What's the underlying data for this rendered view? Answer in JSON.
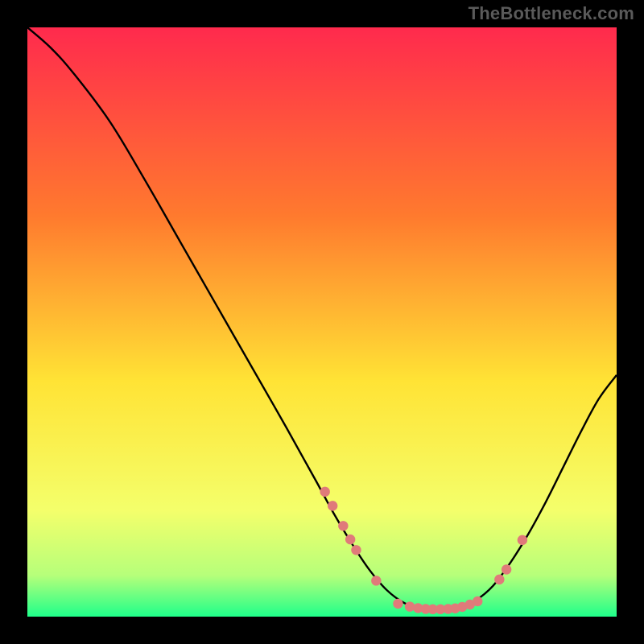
{
  "watermark": "TheBottleneck.com",
  "colors": {
    "background": "#000000",
    "watermark": "#5a5a5a",
    "curve": "#000000",
    "marker_fill": "#e07a7a",
    "marker_stroke": "#c55656",
    "gradient_top": "#ff2a4d",
    "gradient_mid1": "#ff7a2e",
    "gradient_mid2": "#ffe335",
    "gradient_low": "#f4ff6b",
    "gradient_green1": "#b6ff7a",
    "gradient_green2": "#1fff8a"
  },
  "chart_data": {
    "type": "line",
    "title": "",
    "xlabel": "",
    "ylabel": "",
    "xlim": [
      0,
      100
    ],
    "ylim": [
      0,
      100
    ],
    "grid": false,
    "legend": "none",
    "curve": [
      {
        "x": 0,
        "y": 100
      },
      {
        "x": 4,
        "y": 96.5
      },
      {
        "x": 8,
        "y": 92
      },
      {
        "x": 14,
        "y": 84
      },
      {
        "x": 20,
        "y": 74
      },
      {
        "x": 26,
        "y": 63.5
      },
      {
        "x": 32,
        "y": 53
      },
      {
        "x": 38,
        "y": 42.5
      },
      {
        "x": 44,
        "y": 32
      },
      {
        "x": 49,
        "y": 23
      },
      {
        "x": 52,
        "y": 17.5
      },
      {
        "x": 55,
        "y": 12.5
      },
      {
        "x": 58,
        "y": 8
      },
      {
        "x": 61,
        "y": 4.5
      },
      {
        "x": 64,
        "y": 2.3
      },
      {
        "x": 67,
        "y": 1.3
      },
      {
        "x": 70,
        "y": 1.2
      },
      {
        "x": 73,
        "y": 1.4
      },
      {
        "x": 76,
        "y": 2.7
      },
      {
        "x": 79,
        "y": 5.2
      },
      {
        "x": 82,
        "y": 9.2
      },
      {
        "x": 85,
        "y": 14
      },
      {
        "x": 88,
        "y": 19.5
      },
      {
        "x": 91,
        "y": 25.5
      },
      {
        "x": 94,
        "y": 31.5
      },
      {
        "x": 97,
        "y": 37
      },
      {
        "x": 100,
        "y": 41
      }
    ],
    "markers": [
      {
        "x": 50.5,
        "y": 21.2
      },
      {
        "x": 51.8,
        "y": 18.8
      },
      {
        "x": 53.6,
        "y": 15.4
      },
      {
        "x": 54.8,
        "y": 13.1
      },
      {
        "x": 55.8,
        "y": 11.3
      },
      {
        "x": 59.2,
        "y": 6.1
      },
      {
        "x": 62.9,
        "y": 2.2
      },
      {
        "x": 64.9,
        "y": 1.7
      },
      {
        "x": 66.3,
        "y": 1.45
      },
      {
        "x": 67.6,
        "y": 1.3
      },
      {
        "x": 68.8,
        "y": 1.25
      },
      {
        "x": 70.1,
        "y": 1.25
      },
      {
        "x": 71.4,
        "y": 1.3
      },
      {
        "x": 72.6,
        "y": 1.4
      },
      {
        "x": 73.8,
        "y": 1.65
      },
      {
        "x": 75.1,
        "y": 2.05
      },
      {
        "x": 76.4,
        "y": 2.6
      },
      {
        "x": 80.1,
        "y": 6.3
      },
      {
        "x": 81.3,
        "y": 8.0
      },
      {
        "x": 84.0,
        "y": 13.0
      }
    ]
  }
}
